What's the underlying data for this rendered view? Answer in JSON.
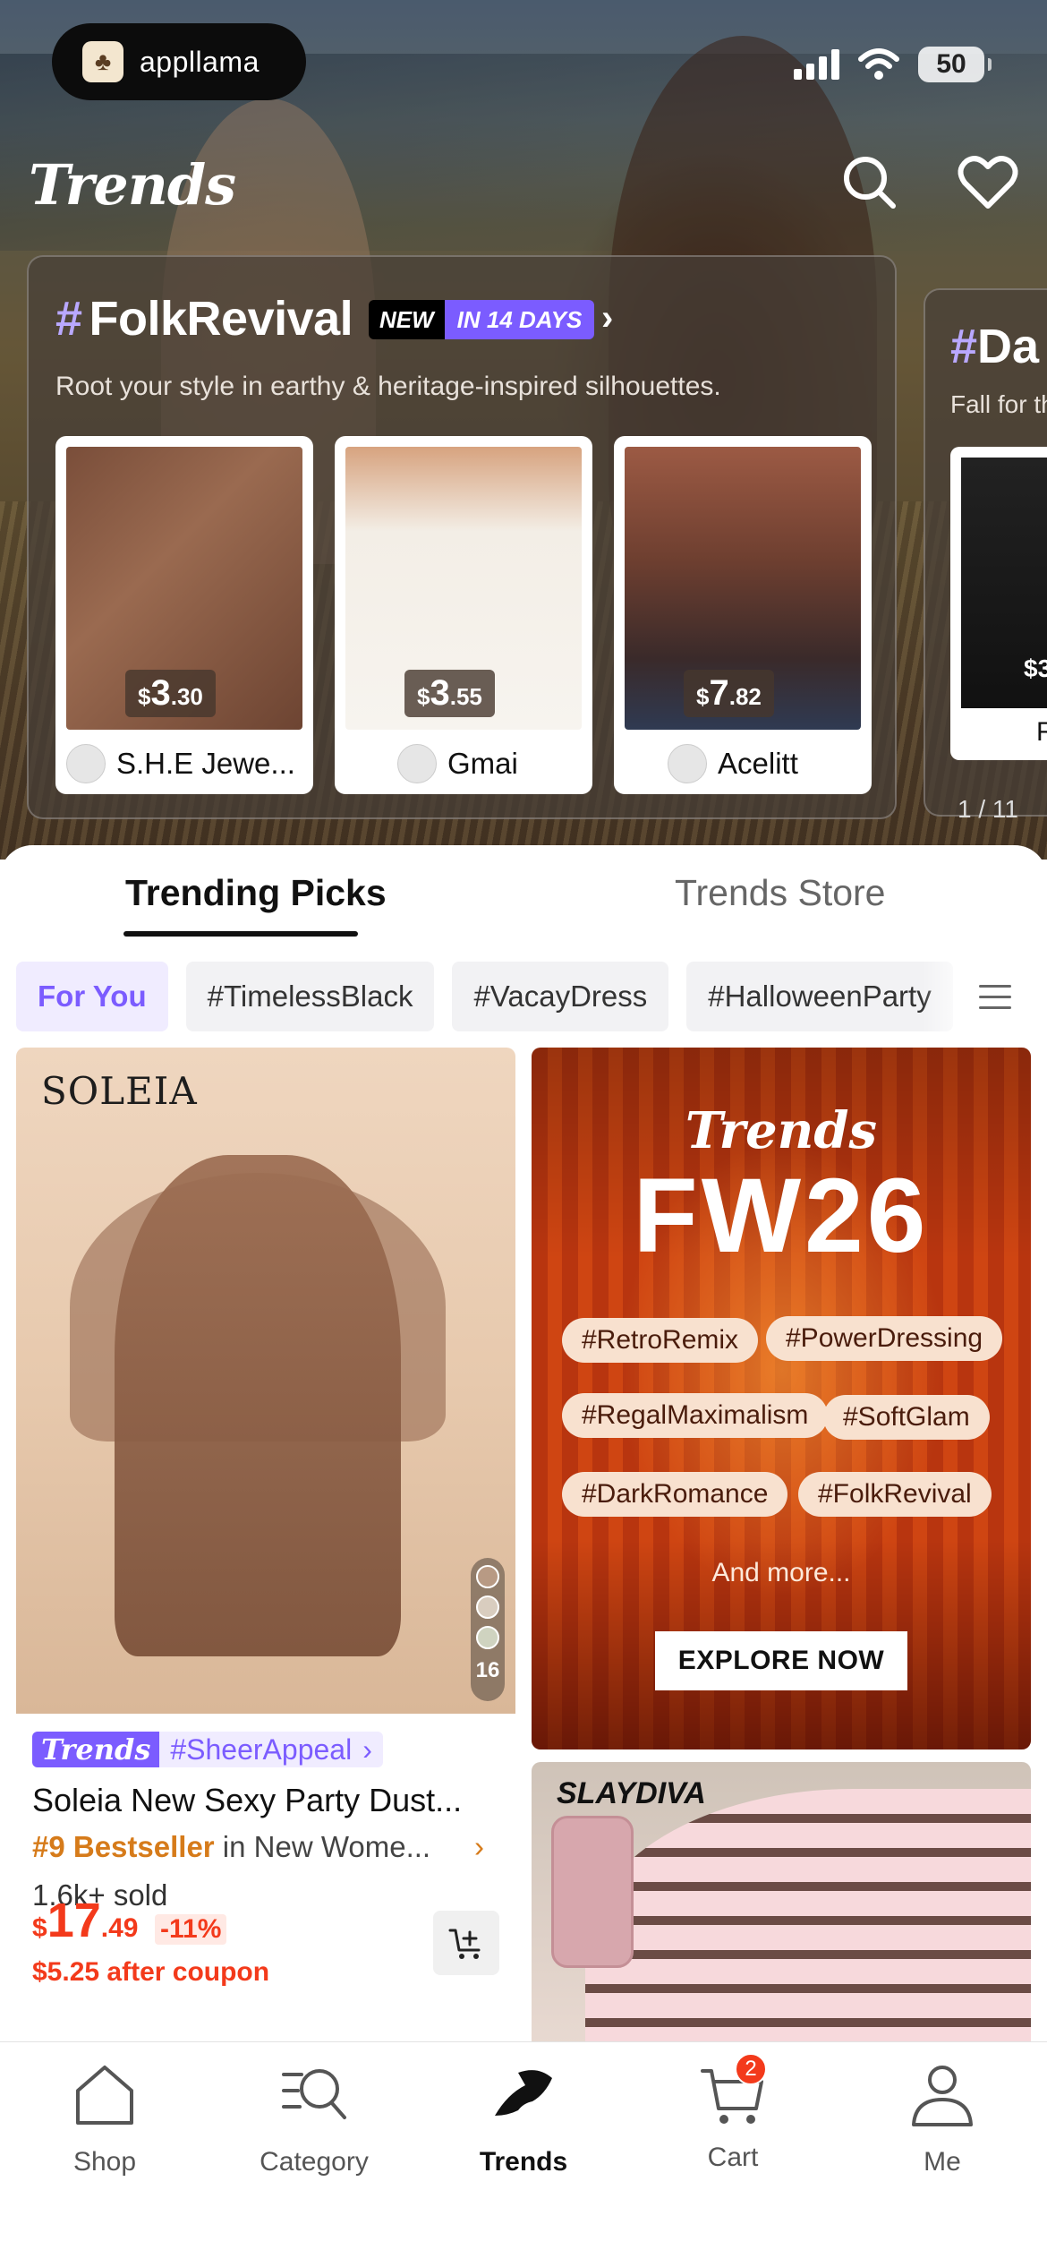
{
  "status_bar": {
    "app_pill_label": "appllama",
    "battery": "50"
  },
  "header": {
    "brand": "Trends",
    "search_icon": "search-icon",
    "wishlist_icon": "heart-icon"
  },
  "featured": {
    "title": "FolkRevival",
    "hash": "#",
    "badge_new": "NEW",
    "badge_days": "IN 14 DAYS",
    "subtitle": "Root your style in earthy & heritage-inspired silhouettes.",
    "products": [
      {
        "price_symbol": "$",
        "price_int": "3",
        "price_dec": ".30",
        "shop": "S.H.E Jewe..."
      },
      {
        "price_symbol": "$",
        "price_int": "3",
        "price_dec": ".55",
        "shop": "Gmai"
      },
      {
        "price_symbol": "$",
        "price_int": "7",
        "price_dec": ".82",
        "shop": "Acelitt"
      }
    ],
    "next_card_title": "Da",
    "next_card_subtitle": "Fall for th",
    "next_card_price": "$3",
    "next_card_shop": "R",
    "pager": "1 / 11"
  },
  "tabs": [
    {
      "label": "Trending Picks",
      "active": true
    },
    {
      "label": "Trends Store",
      "active": false
    }
  ],
  "chips": [
    "For You",
    "#TimelessBlack",
    "#VacayDress",
    "#HalloweenParty"
  ],
  "product_left": {
    "brand_on_image": "SOLEIA",
    "swatch_count": "16",
    "trend_badge": "Trends",
    "trend_tag": "#SheerAppeal",
    "title": "Soleia New Sexy Party Dust...",
    "rank_bold": "#9 Bestseller",
    "rank_rest": " in New Wome...",
    "sold": "1.6k+ sold",
    "price_symbol": "$",
    "price_int": "17",
    "price_dec": ".49",
    "discount": "-11%",
    "coupon": "$5.25 after coupon"
  },
  "banner": {
    "brand": "Trends",
    "heading": "FW26",
    "tags": [
      "#RetroRemix",
      "#PowerDressing",
      "#RegalMaximalism",
      "#SoftGlam",
      "#DarkRomance",
      "#FolkRevival"
    ],
    "more": "And more...",
    "cta": "EXPLORE NOW"
  },
  "product_right2": {
    "brand_on_image": "SLAYDIVA"
  },
  "bottom_nav": [
    {
      "label": "Shop",
      "icon": "home-icon",
      "active": false
    },
    {
      "label": "Category",
      "icon": "category-search-icon",
      "active": false
    },
    {
      "label": "Trends",
      "icon": "trends-icon",
      "active": true
    },
    {
      "label": "Cart",
      "icon": "cart-icon",
      "active": false,
      "badge": "2"
    },
    {
      "label": "Me",
      "icon": "profile-icon",
      "active": false
    }
  ],
  "colors": {
    "accent_purple": "#7b5cff",
    "price_red": "#f33a1b",
    "bestseller_orange": "#d67b1a"
  }
}
